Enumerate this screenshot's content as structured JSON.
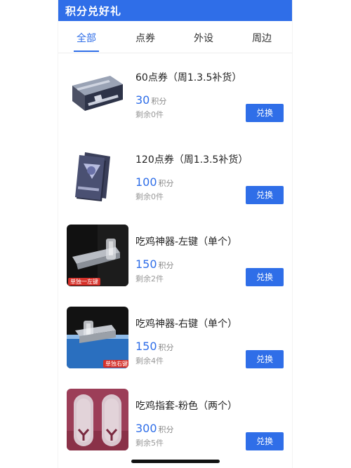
{
  "header": {
    "title": "积分兑好礼"
  },
  "tabs": [
    {
      "label": "全部"
    },
    {
      "label": "点券"
    },
    {
      "label": "外设"
    },
    {
      "label": "周边"
    }
  ],
  "items": [
    {
      "title": "60点券（周1.3.5补货）",
      "price": "30",
      "unit": "积分",
      "stock": "剩余0件",
      "button": "兑换"
    },
    {
      "title": "120点券（周1.3.5补货）",
      "price": "100",
      "unit": "积分",
      "stock": "剩余0件",
      "button": "兑换"
    },
    {
      "title": "吃鸡神器-左键（单个）",
      "price": "150",
      "unit": "积分",
      "stock": "剩余2件",
      "button": "兑换",
      "badge": "单独一左键"
    },
    {
      "title": "吃鸡神器-右键（单个）",
      "price": "150",
      "unit": "积分",
      "stock": "剩余4件",
      "button": "兑换",
      "badge": "单独右键"
    },
    {
      "title": "吃鸡指套-粉色（两个）",
      "price": "300",
      "unit": "积分",
      "stock": "剩余5件",
      "button": "兑换"
    }
  ],
  "colors": {
    "accent": "#2f6ee8",
    "header_bg": "#2f6ee8",
    "badge": "#d6312a"
  },
  "icons": {
    "item_0": "coupon-case-icon",
    "item_1": "coupon-cards-icon",
    "item_2": "trigger-left-icon",
    "item_3": "trigger-right-icon",
    "item_4": "finger-sleeve-icon"
  }
}
